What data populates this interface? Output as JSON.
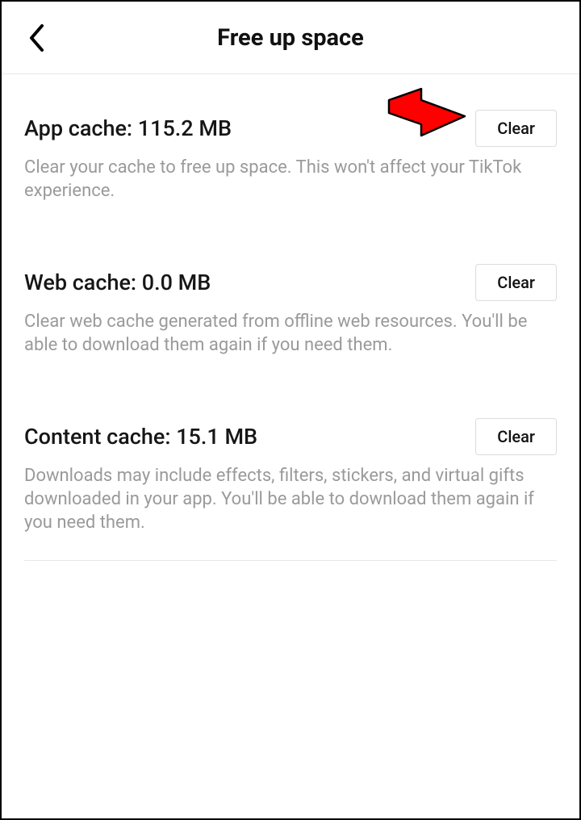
{
  "header": {
    "title": "Free up space"
  },
  "sections": {
    "app_cache": {
      "title": "App cache: 115.2 MB",
      "description": "Clear your cache to free up space. This won't affect your TikTok experience.",
      "button": "Clear"
    },
    "web_cache": {
      "title": "Web cache: 0.0 MB",
      "description": "Clear web cache generated from offline web resources. You'll be able to download them again if you need them.",
      "button": "Clear"
    },
    "content_cache": {
      "title": "Content cache: 15.1 MB",
      "description": "Downloads may include effects, filters, stickers, and virtual gifts downloaded in your app. You'll be able to download them again if you need them.",
      "button": "Clear"
    }
  }
}
